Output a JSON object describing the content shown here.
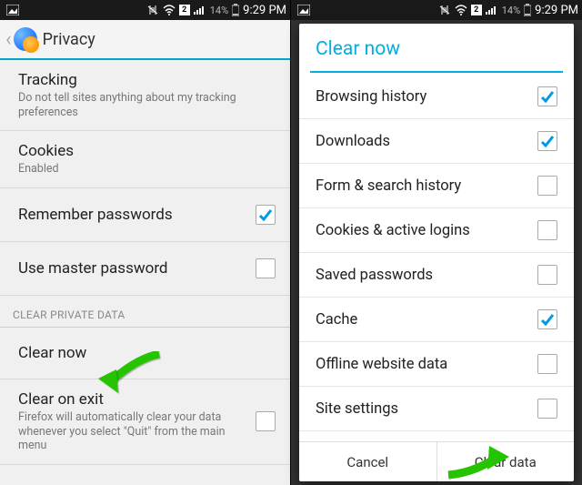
{
  "statusbar": {
    "battery_text": "14%",
    "time": "9:29 PM",
    "sim_badge": "2"
  },
  "left": {
    "actionbar_title": "Privacy",
    "items": {
      "tracking": {
        "title": "Tracking",
        "sub": "Do not tell sites anything about my tracking preferences"
      },
      "cookies": {
        "title": "Cookies",
        "sub": "Enabled"
      },
      "remember": {
        "title": "Remember passwords",
        "checked": true
      },
      "master": {
        "title": "Use master password",
        "checked": false
      },
      "section": "CLEAR PRIVATE DATA",
      "clear_now": {
        "title": "Clear now"
      },
      "clear_exit": {
        "title": "Clear on exit",
        "sub": "Firefox will automatically clear your data whenever you select \"Quit\" from the main menu",
        "checked": false
      }
    }
  },
  "right": {
    "dialog_title": "Clear now",
    "options": [
      {
        "label": "Browsing history",
        "checked": true
      },
      {
        "label": "Downloads",
        "checked": true
      },
      {
        "label": "Form & search history",
        "checked": false
      },
      {
        "label": "Cookies & active logins",
        "checked": false
      },
      {
        "label": "Saved passwords",
        "checked": false
      },
      {
        "label": "Cache",
        "checked": true
      },
      {
        "label": "Offline website data",
        "checked": false
      },
      {
        "label": "Site settings",
        "checked": false
      }
    ],
    "btn_cancel": "Cancel",
    "btn_clear": "Clear data"
  }
}
